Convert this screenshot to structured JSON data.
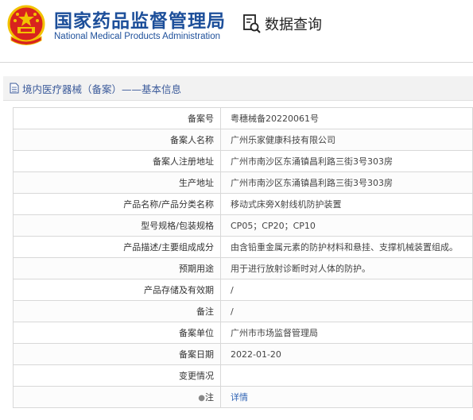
{
  "header": {
    "org_cn": "国家药品监督管理局",
    "org_en": "National Medical Products Administration",
    "data_query_label": "数据查询"
  },
  "section_title": "境内医疗器械（备案）——基本信息",
  "rows": [
    {
      "label": "备案号",
      "value": "粤穗械备20220061号"
    },
    {
      "label": "备案人名称",
      "value": "广州乐家健康科技有限公司"
    },
    {
      "label": "备案人注册地址",
      "value": "广州市南沙区东涌镇昌利路三街3号303房"
    },
    {
      "label": "生产地址",
      "value": "广州市南沙区东涌镇昌利路三街3号303房"
    },
    {
      "label": "产品名称/产品分类名称",
      "value": "移动式床旁X射线机防护装置"
    },
    {
      "label": "型号规格/包装规格",
      "value": "CP05；CP20；CP10"
    },
    {
      "label": "产品描述/主要组成成分",
      "value": "由含铅重金属元素的防护材料和悬挂、支撑机械装置组成。"
    },
    {
      "label": "预期用途",
      "value": "用于进行放射诊断时对人体的防护。"
    },
    {
      "label": "产品存储及有效期",
      "value": "/"
    },
    {
      "label": "备注",
      "value": "/"
    },
    {
      "label": "备案单位",
      "value": "广州市市场监督管理局"
    },
    {
      "label": "备案日期",
      "value": "2022-01-20"
    },
    {
      "label": "变更情况",
      "value": ""
    }
  ],
  "note_row": {
    "label": "注",
    "link_text": "详情"
  },
  "colors": {
    "brand_blue": "#1d4f9a",
    "link": "#2f63b4",
    "emblem_red": "#d8231e",
    "emblem_gold": "#f2c200"
  },
  "icons": {
    "emblem": "national-emblem",
    "query": "magnifier-document-icon",
    "doc": "document-icon",
    "bulb": "lightbulb-icon"
  }
}
